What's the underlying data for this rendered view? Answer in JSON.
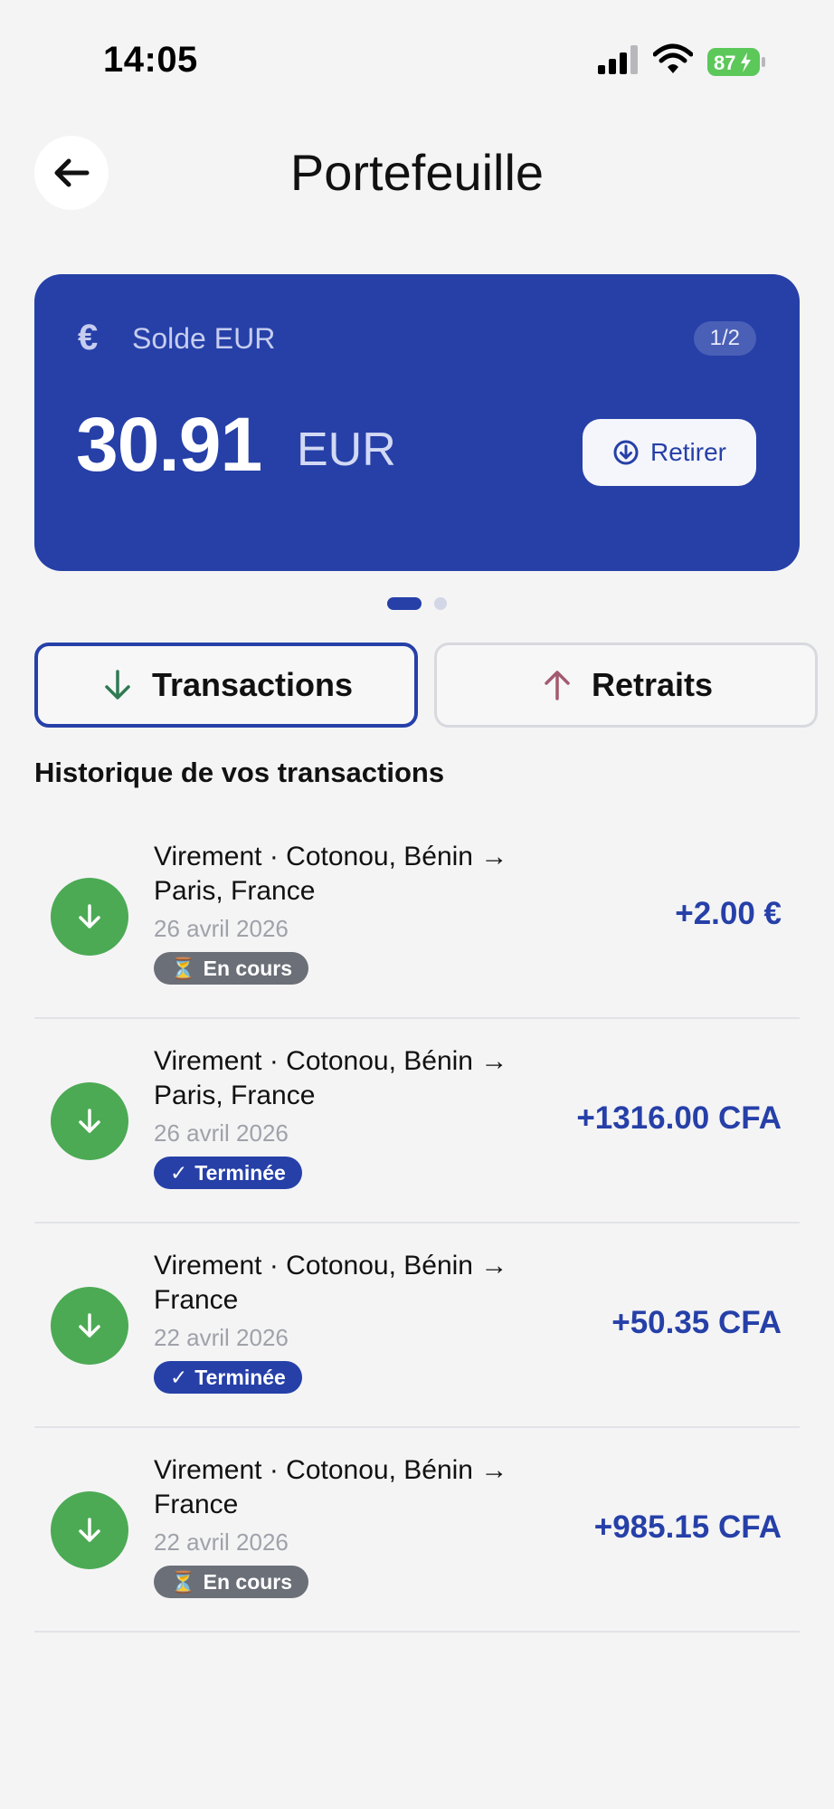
{
  "status_bar": {
    "time": "14:05",
    "battery": "87"
  },
  "header": {
    "title": "Portefeuille"
  },
  "balance_card": {
    "label": "Solde EUR",
    "page_indicator": "1/2",
    "amount": "30.91",
    "currency": "EUR",
    "withdraw_label": "Retirer"
  },
  "tabs": {
    "transactions": "Transactions",
    "withdrawals": "Retraits"
  },
  "section_title": "Historique de vos transactions",
  "transactions": [
    {
      "title": "Virement · Cotonou, Bénin → Paris, France",
      "date": "26 avril 2026",
      "status": "En cours",
      "status_icon": "⏳",
      "amount": "+2.00 €"
    },
    {
      "title": "Virement · Cotonou, Bénin → Paris, France",
      "date": "26 avril 2026",
      "status": "Terminée",
      "status_icon": "✓",
      "amount": "+1316.00 CFA"
    },
    {
      "title": "Virement · Cotonou, Bénin → France",
      "date": "22 avril 2026",
      "status": "Terminée",
      "status_icon": "✓",
      "amount": "+50.35 CFA"
    },
    {
      "title": "Virement · Cotonou, Bénin → France",
      "date": "22 avril 2026",
      "status": "En cours",
      "status_icon": "⏳",
      "amount": "+985.15 CFA"
    }
  ],
  "colors": {
    "primary": "#2640a8",
    "success": "#4caa54",
    "pending": "#6b6f78",
    "background": "#f4f4f5"
  }
}
